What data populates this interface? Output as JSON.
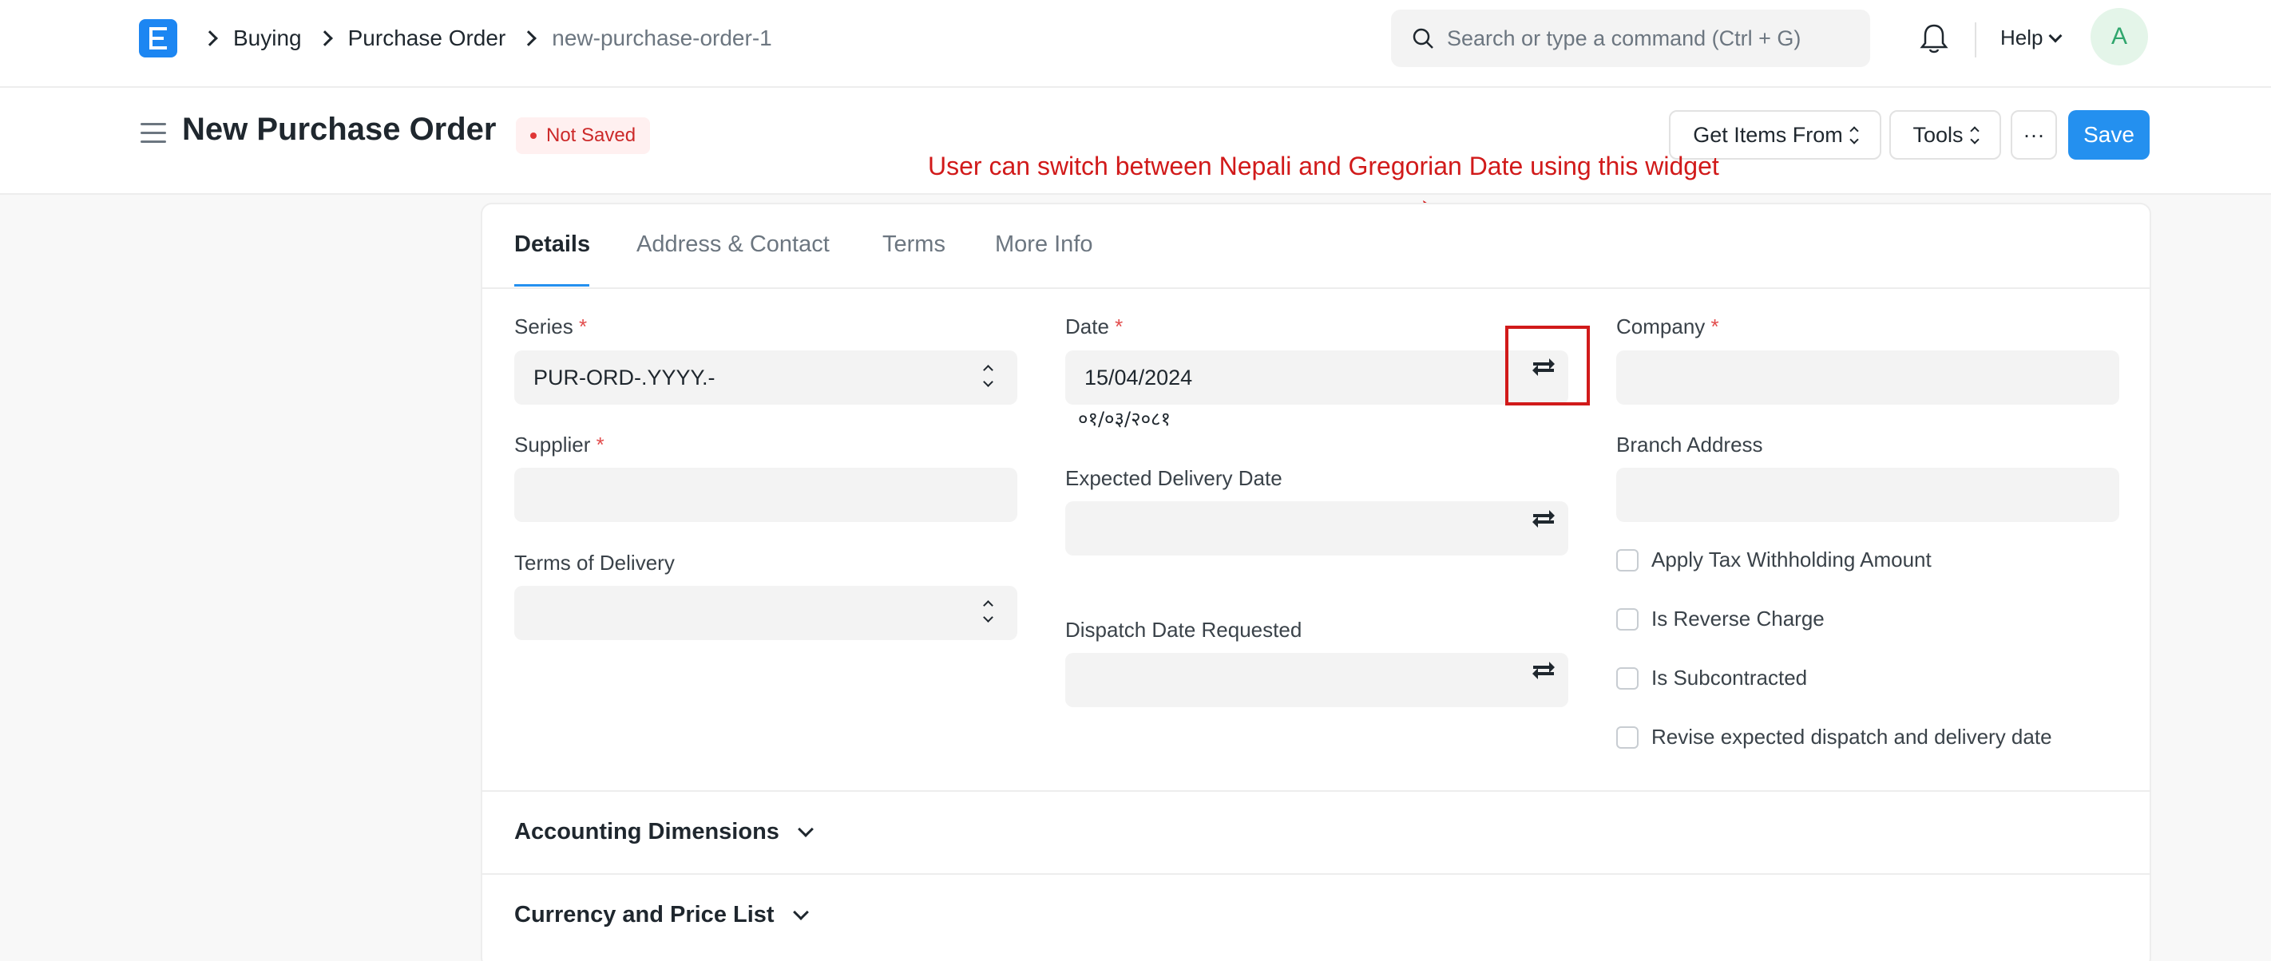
{
  "navbar": {
    "logo_letter": "E",
    "breadcrumbs": [
      "Buying",
      "Purchase Order",
      "new-purchase-order-1"
    ],
    "search_placeholder": "Search or type a command (Ctrl + G)",
    "help_label": "Help",
    "avatar_initial": "A"
  },
  "page": {
    "title": "New Purchase Order",
    "status": "Not Saved",
    "buttons": {
      "get_items": "Get Items From",
      "tools": "Tools",
      "more": "···",
      "save": "Save"
    },
    "annotation": "User can switch between Nepali and Gregorian Date using this widget"
  },
  "tabs": [
    "Details",
    "Address & Contact",
    "Terms",
    "More Info"
  ],
  "form": {
    "series": {
      "label": "Series",
      "value": "PUR-ORD-.YYYY.-"
    },
    "supplier": {
      "label": "Supplier",
      "value": ""
    },
    "terms_of_delivery": {
      "label": "Terms of Delivery",
      "value": ""
    },
    "date": {
      "label": "Date",
      "value": "15/04/2024",
      "nepali_value": "०१/०३/२०८१"
    },
    "expected_delivery_date": {
      "label": "Expected Delivery Date",
      "value": ""
    },
    "dispatch_date_requested": {
      "label": "Dispatch Date Requested",
      "value": ""
    },
    "company": {
      "label": "Company",
      "value": ""
    },
    "branch_address": {
      "label": "Branch Address",
      "value": ""
    },
    "checkboxes": [
      "Apply Tax Withholding Amount",
      "Is Reverse Charge",
      "Is Subcontracted",
      "Revise expected dispatch and delivery date"
    ],
    "required_marker": "*"
  },
  "sections": [
    "Accounting Dimensions",
    "Currency and Price List"
  ],
  "colors": {
    "primary": "#2490ef",
    "logo": "#1c86f2",
    "annotation": "#d11a1a",
    "required": "#e24c4c"
  }
}
